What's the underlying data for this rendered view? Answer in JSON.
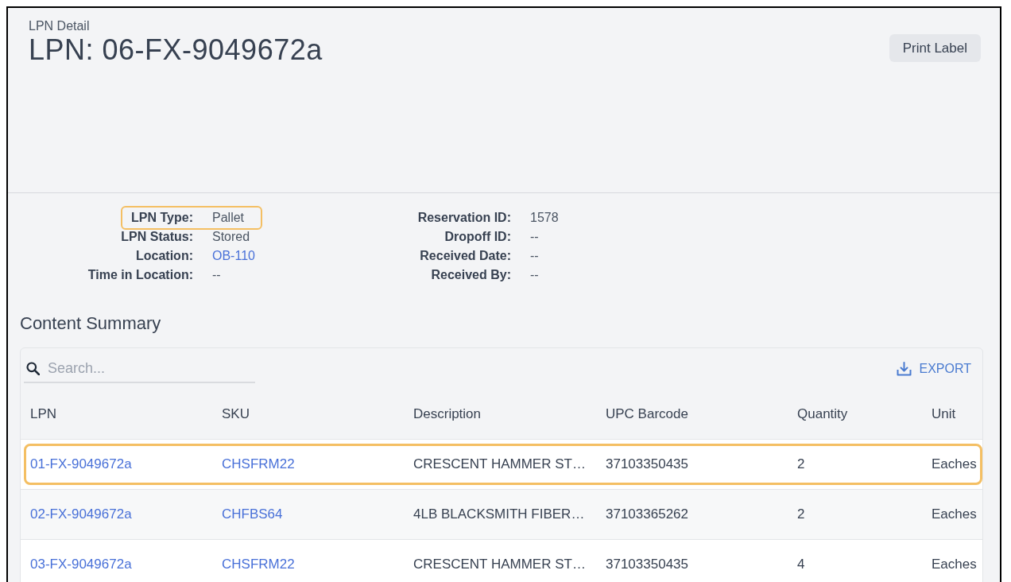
{
  "header": {
    "breadcrumb": "LPN Detail",
    "title": "LPN: 06-FX-9049672a",
    "actions": [
      {
        "label": "Print Label"
      }
    ]
  },
  "details": {
    "columns": [
      {
        "fields": [
          {
            "label": "LPN Type:",
            "value": "Pallet",
            "kind": "text",
            "highlighted": true
          },
          {
            "label": "LPN Status:",
            "value": "Stored",
            "kind": "text",
            "highlighted": false
          },
          {
            "label": "Location:",
            "value": "OB-110",
            "kind": "link",
            "highlighted": false
          },
          {
            "label": "Time in Location:",
            "value": "--",
            "kind": "text",
            "highlighted": false
          }
        ]
      },
      {
        "fields": [
          {
            "label": "Reservation ID:",
            "value": "1578",
            "kind": "text",
            "highlighted": false
          },
          {
            "label": "Dropoff ID:",
            "value": "--",
            "kind": "text",
            "highlighted": false
          },
          {
            "label": "Received Date:",
            "value": "--",
            "kind": "text",
            "highlighted": false
          },
          {
            "label": "Received By:",
            "value": "--",
            "kind": "text",
            "highlighted": false
          }
        ]
      }
    ]
  },
  "content_summary": {
    "title": "Content Summary",
    "search": {
      "placeholder": "Search..."
    },
    "export": {
      "label": "EXPORT"
    },
    "table": {
      "columns": [
        {
          "label": "LPN",
          "kind": "link"
        },
        {
          "label": "SKU",
          "kind": "link"
        },
        {
          "label": "Description",
          "kind": "text"
        },
        {
          "label": "UPC Barcode",
          "kind": "text"
        },
        {
          "label": "Quantity",
          "kind": "text"
        },
        {
          "label": "Unit",
          "kind": "text"
        }
      ],
      "rows": [
        {
          "highlighted": true,
          "cells": [
            "01-FX-9049672a",
            "CHSFRM22",
            "CRESCENT HAMMER ST…",
            "37103350435",
            "2",
            "Eaches"
          ]
        },
        {
          "highlighted": false,
          "cells": [
            "02-FX-9049672a",
            "CHFBS64",
            "4LB BLACKSMITH FIBER…",
            "37103365262",
            "2",
            "Eaches"
          ]
        },
        {
          "highlighted": false,
          "cells": [
            "03-FX-9049672a",
            "CHSFRM22",
            "CRESCENT HAMMER ST…",
            "37103350435",
            "4",
            "Eaches"
          ]
        }
      ]
    }
  }
}
